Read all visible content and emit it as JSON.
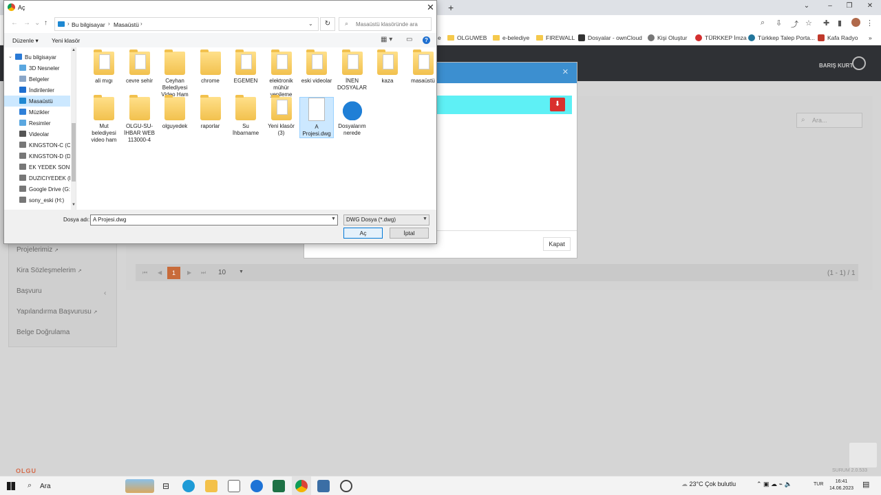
{
  "browser": {
    "new_tab": "+",
    "window_controls": [
      "⌄",
      "–",
      "❐",
      "✕"
    ],
    "bookmarks": [
      {
        "label": "e",
        "kind": "folder"
      },
      {
        "label": "OLGUWEB",
        "kind": "folder"
      },
      {
        "label": "e-belediye",
        "kind": "folder"
      },
      {
        "label": "FIREWALL",
        "kind": "folder"
      },
      {
        "label": "Dosyalar - ownCloud",
        "kind": "site"
      },
      {
        "label": "Kişi Oluştur",
        "kind": "site"
      },
      {
        "label": "TÜRKKEP İmza",
        "kind": "site"
      },
      {
        "label": "Türkkep Talep Porta...",
        "kind": "site"
      },
      {
        "label": "Kafa Radyo",
        "kind": "site"
      }
    ],
    "more": "»"
  },
  "app": {
    "user_name": "BARIŞ KURT",
    "sidebar": [
      {
        "label": "Projelerimiz",
        "icon": "external-link-icon"
      },
      {
        "label": "Kira Sözleşmelerim",
        "icon": "external-link-icon"
      },
      {
        "label": "Başvuru",
        "icon": "chevron-left-icon"
      },
      {
        "label": "Yapılandırma Başvurusu",
        "icon": "external-link-icon"
      },
      {
        "label": "Belge Doğrulama",
        "icon": ""
      }
    ],
    "search_placeholder": "Ara...",
    "pager": {
      "current": "1",
      "page_size": "10",
      "info": "(1 - 1) / 1"
    },
    "logo": "OLGU",
    "version": "SURUM 2.0.533"
  },
  "modal": {
    "close": "×",
    "close_button": "Kapat"
  },
  "dialog": {
    "title": "Aç",
    "breadcrumb": [
      "Bu bilgisayar",
      "Masaüstü"
    ],
    "search_placeholder": "Masaüstü klasöründe ara",
    "toolbar": {
      "organize": "Düzenle",
      "new_folder": "Yeni klasör"
    },
    "nav_items": [
      {
        "label": "Bu bilgisayar",
        "icon": "computer-icon",
        "color": "#2a7ad6"
      },
      {
        "label": "3D Nesneler",
        "icon": "cube-icon",
        "color": "#5aa7e0"
      },
      {
        "label": "Belgeler",
        "icon": "document-icon",
        "color": "#8aa6c8"
      },
      {
        "label": "İndirilenler",
        "icon": "download-icon",
        "color": "#1e6fd0"
      },
      {
        "label": "Masaüstü",
        "icon": "desktop-icon",
        "color": "#1e88d2"
      },
      {
        "label": "Müzikler",
        "icon": "music-icon",
        "color": "#2f80d8"
      },
      {
        "label": "Resimler",
        "icon": "pictures-icon",
        "color": "#5aa7e0"
      },
      {
        "label": "Videolar",
        "icon": "video-icon",
        "color": "#555555"
      },
      {
        "label": "KINGSTON-C (C:",
        "icon": "drive-icon",
        "color": "#777777"
      },
      {
        "label": "KINGSTON-D (D:",
        "icon": "drive-icon",
        "color": "#777777"
      },
      {
        "label": "EK YEDEK SONY",
        "icon": "drive-icon",
        "color": "#777777"
      },
      {
        "label": "DUZICIYEDEK (F:",
        "icon": "drive-icon",
        "color": "#777777"
      },
      {
        "label": "Google Drive (G:",
        "icon": "drive-icon",
        "color": "#777777"
      },
      {
        "label": "sony_eski (H:)",
        "icon": "drive-icon",
        "color": "#777777"
      }
    ],
    "selected_nav": 4,
    "files": [
      {
        "name": "ali mıgı",
        "kind": "folder-docs"
      },
      {
        "name": "cevre sehir",
        "kind": "folder-docs"
      },
      {
        "name": "Ceyhan Belediyesi Video Ham",
        "kind": "folder"
      },
      {
        "name": "chrome",
        "kind": "folder"
      },
      {
        "name": "EGEMEN",
        "kind": "folder-docs"
      },
      {
        "name": "elektronik mühür yenileme",
        "kind": "folder-docs"
      },
      {
        "name": "eski videolar",
        "kind": "folder-docs"
      },
      {
        "name": "İNEN DOSYALAR",
        "kind": "folder-docs"
      },
      {
        "name": "kaza",
        "kind": "folder-docs"
      },
      {
        "name": "masaüstü",
        "kind": "folder-docs"
      },
      {
        "name": "Mut belediyesi video ham",
        "kind": "folder"
      },
      {
        "name": "OLGU-SU-İHBAR WEB 113000-4",
        "kind": "folder"
      },
      {
        "name": "olguyedek",
        "kind": "folder"
      },
      {
        "name": "raporlar",
        "kind": "folder"
      },
      {
        "name": "Su İhbarname",
        "kind": "folder"
      },
      {
        "name": "Yeni klasör (3)",
        "kind": "folder-docs"
      },
      {
        "name": "A Projesi.dwg",
        "kind": "file"
      },
      {
        "name": "Dosyalarım nerede",
        "kind": "cloud"
      }
    ],
    "filename_label": "Dosya adı:",
    "filename_value": "A Projesi.dwg",
    "filetype_value": "DWG Dosya (*.dwg)",
    "open_button": "Aç",
    "cancel_button": "İptal"
  },
  "taskbar": {
    "search": "Ara",
    "weather": "23°C  Çok bulutlu",
    "language": "TUR",
    "time": "16:41",
    "date": "14.06.2023"
  }
}
